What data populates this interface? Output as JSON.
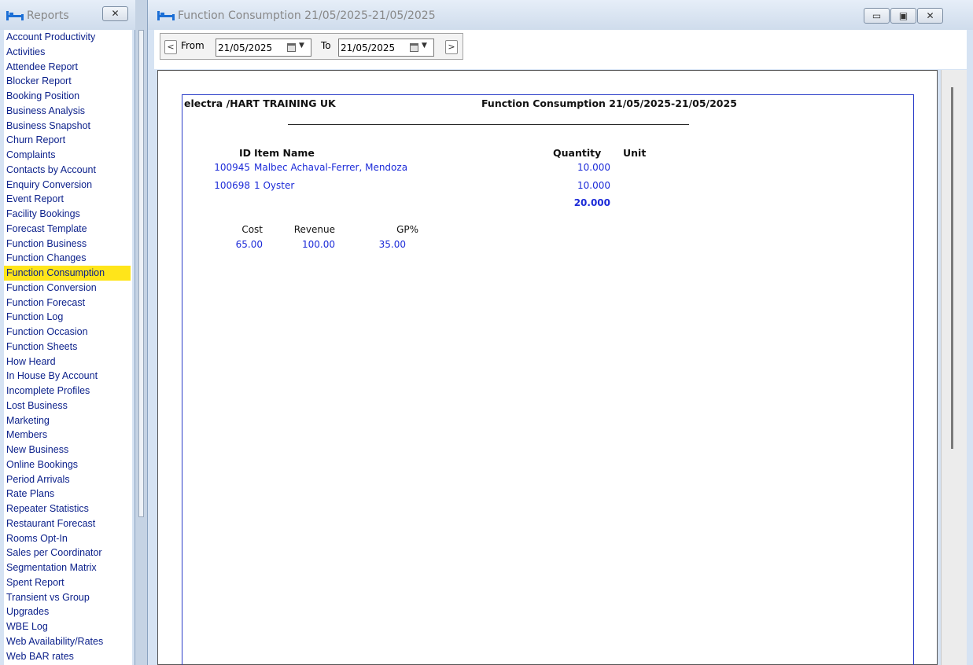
{
  "reports_window": {
    "title": "Reports",
    "close_glyph": "✕",
    "items": [
      "Account Productivity",
      "Activities",
      "Attendee Report",
      "Blocker Report",
      "Booking Position",
      "Business Analysis",
      "Business Snapshot",
      "Churn Report",
      "Complaints",
      "Contacts by Account",
      "Enquiry Conversion",
      "Event Report",
      "Facility Bookings",
      "Forecast Template",
      "Function Business",
      "Function Changes",
      "Function Consumption",
      "Function Conversion",
      "Function Forecast",
      "Function Log",
      "Function Occasion",
      "Function Sheets",
      "How Heard",
      "In House By Account",
      "Incomplete Profiles",
      "Lost Business",
      "Marketing",
      "Members",
      "New Business",
      "Online Bookings",
      "Period Arrivals",
      "Rate Plans",
      "Repeater Statistics",
      "Restaurant Forecast",
      "Rooms Opt-In",
      "Sales per Coordinator",
      "Segmentation Matrix",
      "Spent Report",
      "Transient vs Group",
      "Upgrades",
      "WBE Log",
      "Web Availability/Rates",
      "Web BAR rates"
    ],
    "selected_index": 16
  },
  "main_window": {
    "title": "Function Consumption 21/05/2025-21/05/2025",
    "buttons": {
      "minimize": "▭",
      "maximize": "▣",
      "close": "✕"
    }
  },
  "toolbar": {
    "prev_glyph": "<",
    "next_glyph": ">",
    "from_label": "From",
    "to_label": "To",
    "from_value": "21/05/2025",
    "to_value": "21/05/2025",
    "dropdown_glyph": "▼"
  },
  "report": {
    "header_left": "electra /HART TRAINING UK",
    "header_right": "Function Consumption 21/05/2025-21/05/2025",
    "columns": {
      "id": "ID",
      "name": "Item Name",
      "quantity": "Quantity",
      "unit": "Unit"
    },
    "rows": [
      {
        "id": "100945",
        "name": "Malbec Achaval-Ferrer, Mendoza",
        "quantity": "10.000",
        "unit": ""
      },
      {
        "id": "100698",
        "name": "1 Oyster",
        "quantity": "10.000",
        "unit": ""
      }
    ],
    "total_quantity": "20.000",
    "summary": {
      "cost_label": "Cost",
      "revenue_label": "Revenue",
      "gp_label": "GP%",
      "cost": "65.00",
      "revenue": "100.00",
      "gp": "35.00"
    }
  },
  "colors": {
    "report_text": "#1c2bd8",
    "selected_bg": "#ffe51a",
    "list_text": "#0a1f8a"
  }
}
